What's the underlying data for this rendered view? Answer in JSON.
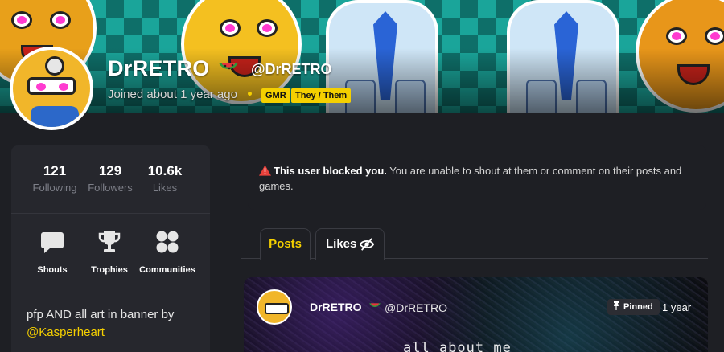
{
  "profile": {
    "display_name": "DrRETRO",
    "handle": "@DrRETRO",
    "joined": "Joined about 1 year ago",
    "badges": [
      "GMR",
      "They / Them"
    ]
  },
  "stats": [
    {
      "value": "121",
      "label": "Following"
    },
    {
      "value": "129",
      "label": "Followers"
    },
    {
      "value": "10.6k",
      "label": "Likes"
    }
  ],
  "nav": [
    {
      "label": "Shouts",
      "icon": "speech-bubble-icon"
    },
    {
      "label": "Trophies",
      "icon": "trophy-icon"
    },
    {
      "label": "Communities",
      "icon": "communities-icon"
    }
  ],
  "bio": {
    "text": "pfp AND all art in banner by",
    "link": "@Kasperheart"
  },
  "notice": {
    "icon": "warning-icon",
    "bold": "This user blocked you.",
    "text": " You are unable to shout at them or comment on their posts and games."
  },
  "tabs": {
    "posts": "Posts",
    "likes": "Likes",
    "likes_icon": "eye-slash-icon"
  },
  "post": {
    "author": "DrRETRO",
    "handle": "@DrRETRO",
    "pinned": "Pinned",
    "time": "1 year",
    "title": "all about me"
  },
  "colors": {
    "accent": "#f5d000",
    "background": "#1e1f24",
    "card": "#26272d",
    "muted_text": "#7d7f88"
  }
}
